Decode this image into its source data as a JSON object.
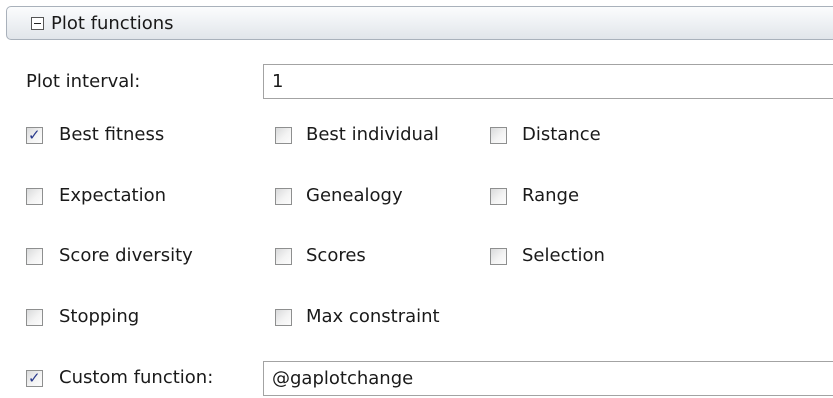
{
  "header": {
    "title": "Plot functions",
    "toggle_icon": "collapse-minus-icon"
  },
  "plot_interval": {
    "label": "Plot interval:",
    "value": "1"
  },
  "checkboxes": {
    "best_fitness": {
      "label": "Best fitness",
      "checked": true
    },
    "best_individual": {
      "label": "Best individual",
      "checked": false
    },
    "distance": {
      "label": "Distance",
      "checked": false
    },
    "expectation": {
      "label": "Expectation",
      "checked": false
    },
    "genealogy": {
      "label": "Genealogy",
      "checked": false
    },
    "range": {
      "label": "Range",
      "checked": false
    },
    "score_diversity": {
      "label": "Score diversity",
      "checked": false
    },
    "scores": {
      "label": "Scores",
      "checked": false
    },
    "selection": {
      "label": "Selection",
      "checked": false
    },
    "stopping": {
      "label": "Stopping",
      "checked": false
    },
    "max_constraint": {
      "label": "Max constraint",
      "checked": false
    }
  },
  "custom_function": {
    "label": "Custom function:",
    "checked": true,
    "value": "@gaplotchange"
  },
  "colors": {
    "checkmark": "#2a3a8c",
    "header_border": "#a9b1bb"
  }
}
